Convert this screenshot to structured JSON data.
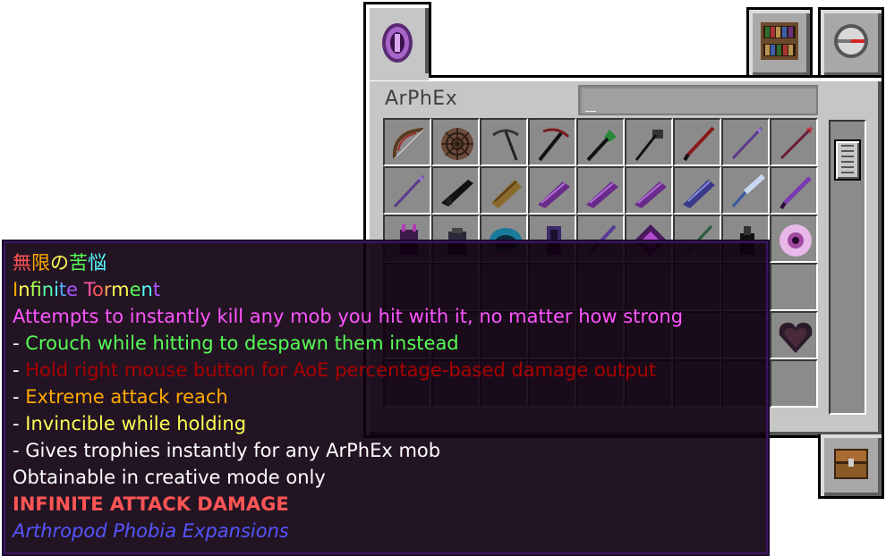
{
  "window": {
    "title": "ArPhEx",
    "search_value": "_",
    "tabs": [
      {
        "name": "arphex-tab",
        "icon": "ender-eye-purple-icon",
        "active": true
      },
      {
        "name": "bookshelf-tab",
        "icon": "bookshelf-icon",
        "active": false
      },
      {
        "name": "compass-tab",
        "icon": "compass-icon",
        "active": false
      },
      {
        "name": "inventory-tab",
        "icon": "chest-icon",
        "active": false
      }
    ]
  },
  "slots": [
    "bow-icon",
    "spider-web-shield-icon",
    "pickaxe-icon",
    "red-pickaxe-icon",
    "green-shovel-icon",
    "axe-icon",
    "red-sword-icon",
    "purple-spear-icon",
    "red-trident-icon",
    "purple-spear-icon",
    "black-gun-icon",
    "wooden-launcher-icon",
    "purple-gun-icon",
    "purple-gun-icon",
    "purple-gun-icon",
    "blue-rifle-icon",
    "silver-lance-icon",
    "purple-sword-icon",
    "purple-armor-icon",
    "dark-armor-icon",
    "blue-orb-icon",
    "purple-ring-icon",
    "purple-wand-icon",
    "purple-gem-icon",
    "green-tool-icon",
    "black-bottle-icon",
    "pink-eye-icon",
    "",
    "",
    "",
    "",
    "",
    "",
    "",
    "",
    "",
    "",
    "",
    "",
    "",
    "",
    "",
    "",
    "",
    "heart-dark-icon",
    "",
    "",
    "",
    "",
    "",
    "",
    "",
    "",
    ""
  ],
  "colors": {
    "panel_bg": "#c6c6c6",
    "slot_bg": "#8b8b8b",
    "tooltip_bg": "#100010",
    "magenta": "#ff55ff",
    "green": "#55ff55",
    "dark_red": "#aa0000",
    "gold": "#ffaa00",
    "yellow": "#ffff55",
    "red": "#ff5555",
    "blue": "#5555ff"
  },
  "tooltip": {
    "title_jp": "無限の苦悩",
    "item_name": "Infinite Torment",
    "description": "Attempts to instantly kill any mob you hit with it, no matter how strong",
    "features": [
      {
        "prefix": "- ",
        "text": "Crouch while hitting to despawn them instead",
        "color": "#55ff55"
      },
      {
        "prefix": "- ",
        "text": "Hold right mouse button for AoE percentage-based damage output",
        "color": "#aa0000"
      },
      {
        "prefix": "- ",
        "text": "Extreme attack reach",
        "color": "#ffaa00"
      },
      {
        "prefix": "- ",
        "text": "Invincible while holding",
        "color": "#ffff55"
      },
      {
        "prefix": "- ",
        "text": "Gives trophies instantly for any ArPhEx mob",
        "color": "#ffffff"
      }
    ],
    "obtain_note": "Obtainable in creative mode only",
    "damage_note": "INFINITE ATTACK DAMAGE",
    "mod_name": "Arthropod Phobia Expansions"
  }
}
